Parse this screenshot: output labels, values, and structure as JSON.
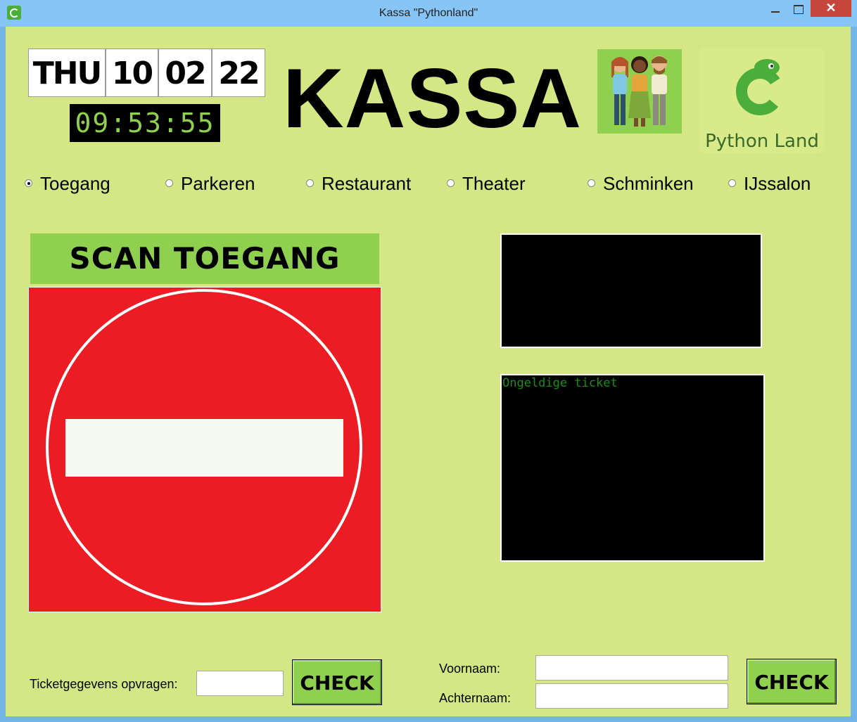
{
  "window": {
    "title": "Kassa \"Pythonland\"",
    "close_glyph": "✕"
  },
  "header": {
    "day": "THU",
    "date_d": "10",
    "date_m": "02",
    "date_y": "22",
    "time": "09:53:55",
    "title": "KASSA",
    "logo_text": "Python Land"
  },
  "radios": [
    {
      "label": "Toegang",
      "selected": true
    },
    {
      "label": "Parkeren",
      "selected": false
    },
    {
      "label": "Restaurant",
      "selected": false
    },
    {
      "label": "Theater",
      "selected": false
    },
    {
      "label": "Schminken",
      "selected": false
    },
    {
      "label": "IJssalon",
      "selected": false
    }
  ],
  "scan": {
    "title": "SCAN TOEGANG",
    "sign": "no-entry-icon"
  },
  "screens": {
    "top_text": "",
    "bottom_text": "Ongeldige ticket"
  },
  "footer": {
    "ticket_label": "Ticketgegevens opvragen:",
    "ticket_value": "",
    "check_left": "CHECK",
    "firstname_label": "Voornaam:",
    "firstname_value": "",
    "lastname_label": "Achternaam:",
    "lastname_value": "",
    "check_right": "CHECK"
  },
  "colors": {
    "background": "#d5e784",
    "accent_green": "#8fd14f",
    "sign_red": "#ec1c24",
    "screen_text": "#1b8c1b"
  }
}
